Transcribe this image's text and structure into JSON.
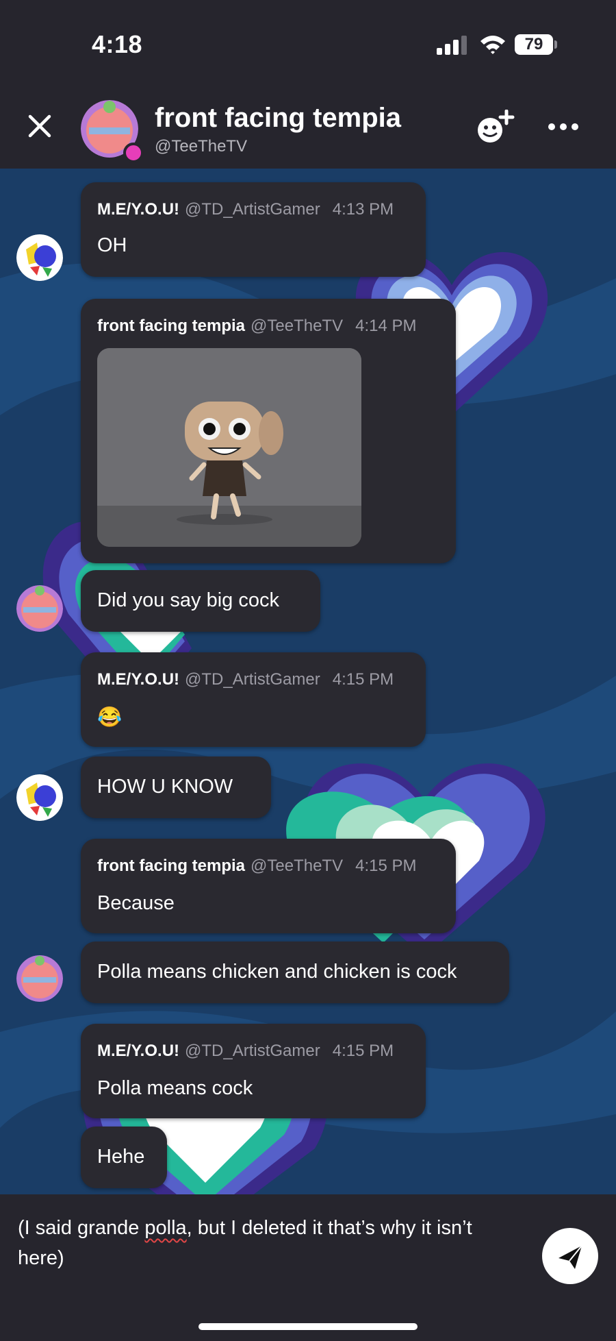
{
  "status_bar": {
    "time": "4:18",
    "battery": "79"
  },
  "header": {
    "title": "front facing tempia",
    "handle": "@TeeTheTV"
  },
  "messages": [
    {
      "name": "M.E/Y.O.U!",
      "handle": "@TD_ArtistGamer",
      "time": "4:13 PM",
      "text": "OH"
    },
    {
      "name": "front facing tempia",
      "handle": "@TeeTheTV",
      "time": "4:14 PM"
    },
    {
      "text": "Did you say big cock"
    },
    {
      "name": "M.E/Y.O.U!",
      "handle": "@TD_ArtistGamer",
      "time": "4:15 PM",
      "text": "😂"
    },
    {
      "text": "HOW U KNOW"
    },
    {
      "name": "front facing tempia",
      "handle": "@TeeTheTV",
      "time": "4:15 PM",
      "text": "Because"
    },
    {
      "text": "Polla means chicken and chicken is cock"
    },
    {
      "name": "M.E/Y.O.U!",
      "handle": "@TD_ArtistGamer",
      "time": "4:15 PM",
      "text": "Polla means cock"
    },
    {
      "text": "Hehe"
    }
  ],
  "composer": {
    "text_before": "(I said grande ",
    "misspelled": "polla",
    "text_after": ", but I deleted it that’s why it isn’t here)"
  },
  "icons": [
    "close-icon",
    "add-friend-icon",
    "more-icon",
    "send-icon",
    "signal-icon",
    "wifi-icon"
  ],
  "colors": {
    "bubble": "#2a2930",
    "background": "#26252d",
    "chat_bg": "#1a3d66",
    "online": "#e63eb9"
  }
}
